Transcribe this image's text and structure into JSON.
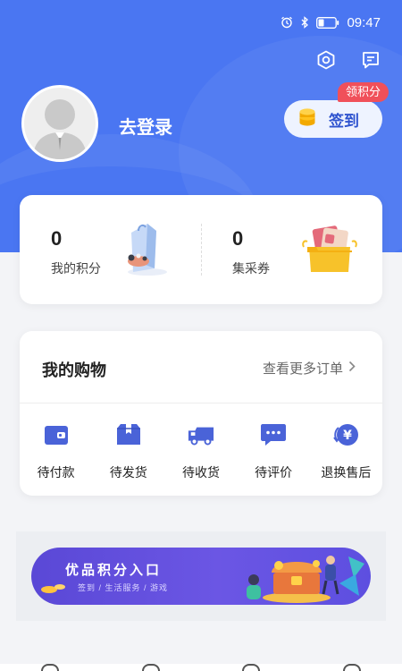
{
  "status_bar": {
    "time": "09:47",
    "icons": [
      "alarm-icon",
      "bluetooth-icon",
      "battery-icon"
    ]
  },
  "header": {
    "actions": [
      "settings-icon",
      "message-icon"
    ],
    "login_text": "去登录",
    "checkin_label": "签到",
    "points_tag": "领积分"
  },
  "stats": [
    {
      "value": "0",
      "label": "我的积分"
    },
    {
      "value": "0",
      "label": "集采券"
    }
  ],
  "orders": {
    "title": "我的购物",
    "more": "查看更多订单",
    "items": [
      {
        "label": "待付款",
        "icon": "wallet-icon"
      },
      {
        "label": "待发货",
        "icon": "box-icon"
      },
      {
        "label": "待收货",
        "icon": "truck-icon"
      },
      {
        "label": "待评价",
        "icon": "comment-icon"
      },
      {
        "label": "退换售后",
        "icon": "refund-icon"
      }
    ]
  },
  "banner": {
    "title": "优品积分入口",
    "subtitle": "签到 / 生活服务 / 游戏"
  },
  "colors": {
    "brand": "#4a76f2",
    "accent": "#2f54cf",
    "tag": "#f0505a",
    "icon": "#4a63d8"
  }
}
